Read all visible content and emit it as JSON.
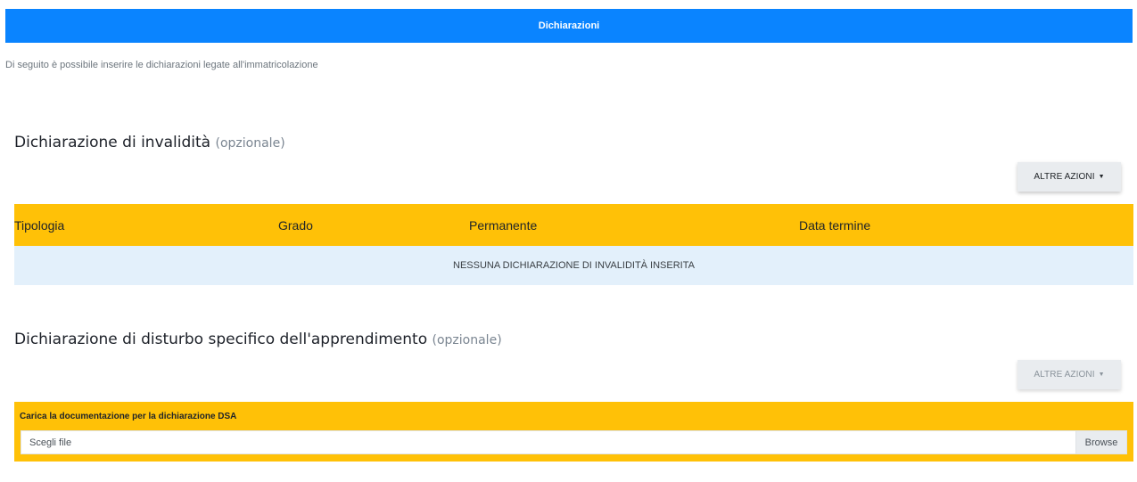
{
  "header": {
    "title": "Dichiarazioni"
  },
  "intro": {
    "text": "Di seguito è possibile inserire le dichiarazioni legate all'immatricolazione"
  },
  "section_invalidita": {
    "title": "Dichiarazione di invalidità",
    "optional": "(opzionale)",
    "actions_button": "ALTRE AZIONI",
    "table": {
      "columns": [
        "Tipologia",
        "Grado",
        "Permanente",
        "Data termine"
      ],
      "empty_message": "NESSUNA DICHIARAZIONE DI INVALIDITÀ INSERITA"
    }
  },
  "section_dsa": {
    "title": "Dichiarazione di disturbo specifico dell'apprendimento",
    "optional": "(opzionale)",
    "actions_button": "ALTRE AZIONI",
    "upload": {
      "label": "Carica la documentazione per la dichiarazione DSA",
      "placeholder": "Scegli file",
      "browse": "Browse"
    }
  },
  "colors": {
    "banner": "#0a84ff",
    "table_header": "#ffc107",
    "empty_row": "#e3f0fb"
  }
}
